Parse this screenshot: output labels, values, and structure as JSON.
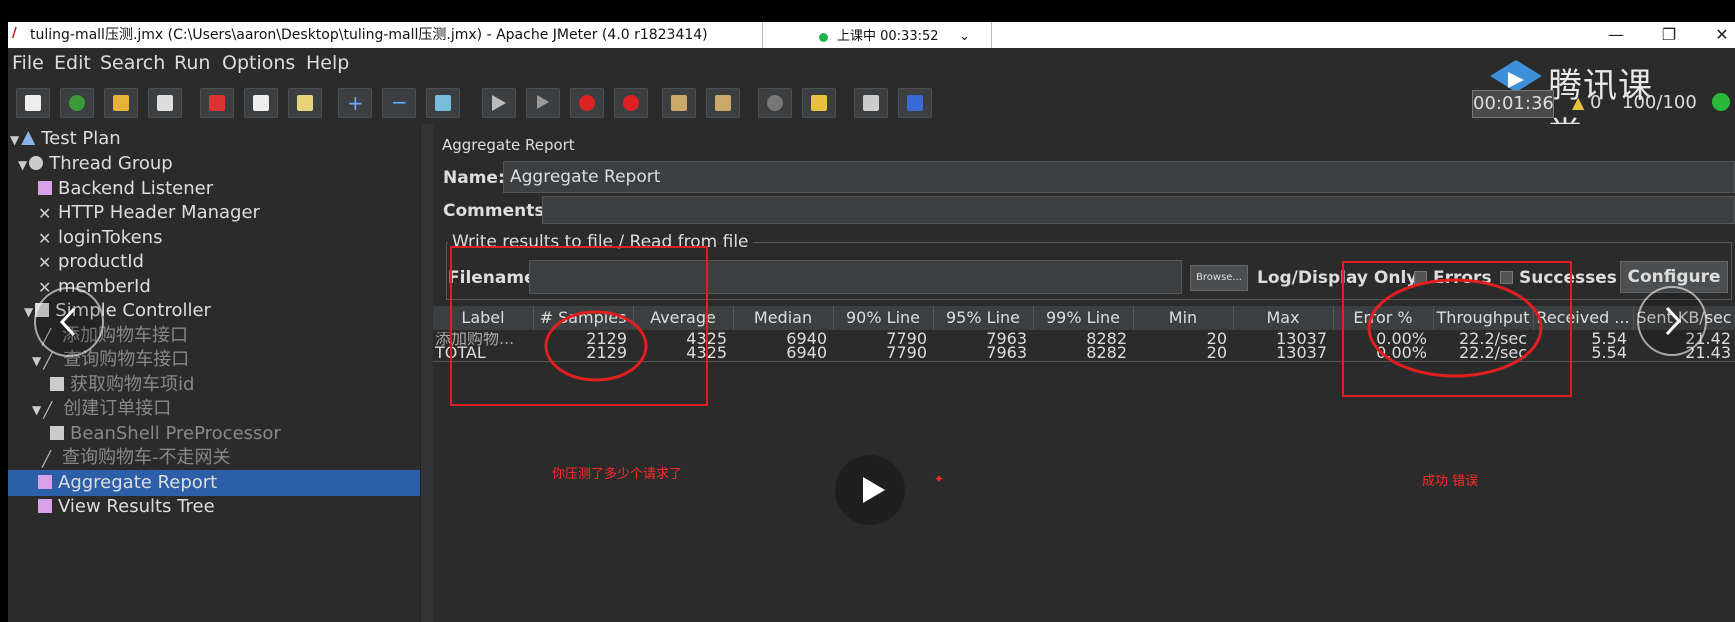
{
  "window": {
    "title": "tuling-mall压测.jmx (C:\\Users\\aaron\\Desktop\\tuling-mall压测.jmx) - Apache JMeter (4.0 r1823414)",
    "minimize": "—",
    "maximize": "❐",
    "close": "✕"
  },
  "live_status": {
    "text": "上课中 00:33:52",
    "caret": "⌄"
  },
  "menu": [
    "File",
    "Edit",
    "Search",
    "Run",
    "Options",
    "Help"
  ],
  "branding": {
    "text": "腾讯课堂"
  },
  "toolbar_status": {
    "timer": "00:01:36",
    "warnings": "0",
    "threads": "100/100"
  },
  "tree": [
    {
      "label": "Test Plan",
      "expanded": true
    },
    {
      "label": "Thread Group",
      "expanded": true
    },
    {
      "label": "Backend Listener"
    },
    {
      "label": "HTTP Header Manager"
    },
    {
      "label": "loginTokens"
    },
    {
      "label": "productId"
    },
    {
      "label": "memberId"
    },
    {
      "label": "Simple Controller",
      "expanded": true
    },
    {
      "label": "添加购物车接口"
    },
    {
      "label": "查询购物车接口",
      "expanded": true
    },
    {
      "label": "获取购物车项id"
    },
    {
      "label": "创建订单接口",
      "expanded": true
    },
    {
      "label": "BeanShell PreProcessor"
    },
    {
      "label": "查询购物车-不走网关"
    },
    {
      "label": "Aggregate Report",
      "selected": true
    },
    {
      "label": "View Results Tree"
    }
  ],
  "report": {
    "heading": "Aggregate Report",
    "name_label": "Name:",
    "name_value": "Aggregate Report",
    "comments_label": "Comments:",
    "file_group_title": "Write results to file / Read from file",
    "filename_label": "Filename",
    "browse_label": "Browse...",
    "log_display_label": "Log/Display Only:",
    "errors_label": "Errors",
    "successes_label": "Successes",
    "configure_label": "Configure"
  },
  "table": {
    "columns": [
      "Label",
      "# Samples",
      "Average",
      "Median",
      "90% Line",
      "95% Line",
      "99% Line",
      "Min",
      "Max",
      "Error %",
      "Throughput",
      "Received ...",
      "Sent KB/sec"
    ],
    "rows": [
      [
        "添加购物...",
        "2129",
        "4325",
        "6940",
        "7790",
        "7963",
        "8282",
        "20",
        "13037",
        "0.00%",
        "22.2/sec",
        "5.54",
        "21.42"
      ],
      [
        "TOTAL",
        "2129",
        "4325",
        "6940",
        "7790",
        "7963",
        "8282",
        "20",
        "13037",
        "0.00%",
        "22.2/sec",
        "5.54",
        "21.43"
      ]
    ]
  },
  "annotations": {
    "samples_note": "你压测了多少个请求了",
    "error_note": "成功 错误"
  },
  "colors": {
    "annotation": "#e02020",
    "selection": "#2d5fa8",
    "live_dot": "#1db34a"
  }
}
